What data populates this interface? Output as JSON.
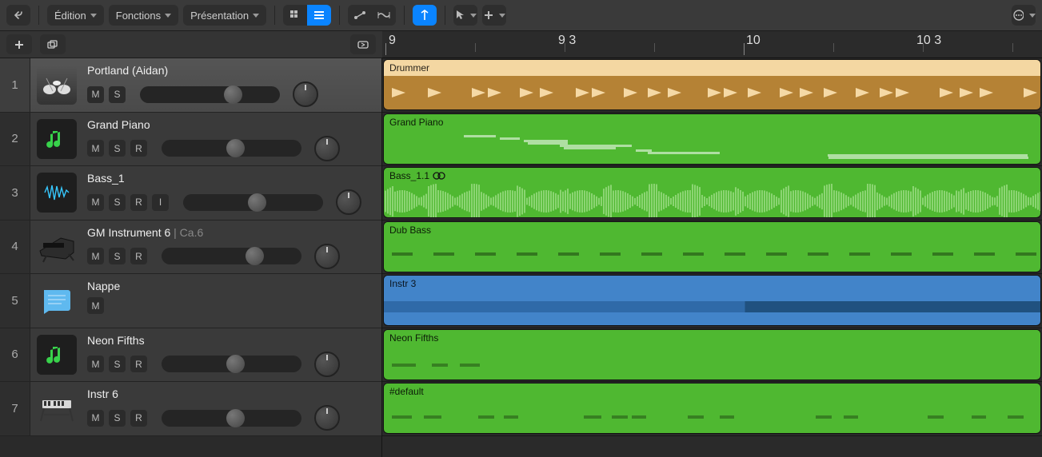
{
  "toolbar": {
    "menus": [
      "Édition",
      "Fonctions",
      "Présentation"
    ]
  },
  "ruler": {
    "labels": [
      "9",
      "9 3",
      "10",
      "10 3"
    ]
  },
  "tracks": [
    {
      "num": "1",
      "name": "Portland (Aidan)",
      "name_sub": "",
      "buttons": [
        "M",
        "S"
      ],
      "vol": 0.7,
      "region_label": "Drummer",
      "region_bg": "#b58235",
      "region_hdr": "#f4d7a2",
      "style": "drummer"
    },
    {
      "num": "2",
      "name": "Grand Piano",
      "name_sub": "",
      "buttons": [
        "M",
        "S",
        "R"
      ],
      "vol": 0.54,
      "region_label": "Grand Piano",
      "region_bg": "#4fb831",
      "region_hdr": "#4fb831",
      "style": "midi-piano"
    },
    {
      "num": "3",
      "name": "Bass_1",
      "name_sub": "",
      "buttons": [
        "M",
        "S",
        "R",
        "I"
      ],
      "vol": 0.54,
      "region_label": "Bass_1.1",
      "region_bg": "#4fb831",
      "region_hdr": "#4fb831",
      "style": "audio-wave",
      "loop_icon": true
    },
    {
      "num": "4",
      "name": "GM Instrument 6",
      "name_sub": " | Ca.6",
      "buttons": [
        "M",
        "S",
        "R"
      ],
      "vol": 0.7,
      "region_label": "Dub Bass",
      "region_bg": "#4fb831",
      "region_hdr": "#4fb831",
      "style": "midi-bass"
    },
    {
      "num": "5",
      "name": "Nappe",
      "name_sub": "",
      "buttons": [
        "M"
      ],
      "vol": null,
      "region_label": "Instr 3",
      "region_bg": "#4284c9",
      "region_hdr": "#4284c9",
      "style": "midi-pad"
    },
    {
      "num": "6",
      "name": "Neon Fifths",
      "name_sub": "",
      "buttons": [
        "M",
        "S",
        "R"
      ],
      "vol": 0.54,
      "region_label": "Neon Fifths",
      "region_bg": "#4fb831",
      "region_hdr": "#4fb831",
      "style": "midi-sparse"
    },
    {
      "num": "7",
      "name": "Instr 6",
      "name_sub": "",
      "buttons": [
        "M",
        "S",
        "R"
      ],
      "vol": 0.54,
      "region_label": "#default",
      "region_bg": "#4fb831",
      "region_hdr": "#4fb831",
      "style": "midi-sparse2"
    }
  ]
}
